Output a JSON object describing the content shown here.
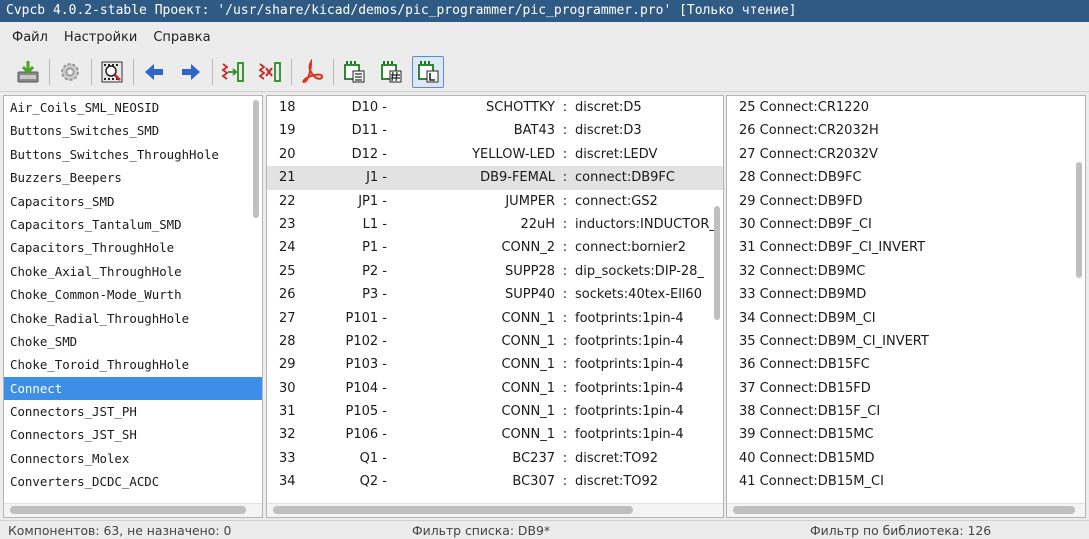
{
  "window": {
    "title": "Cvpcb 4.0.2-stable  Проект: '/usr/share/kicad/demos/pic_programmer/pic_programmer.pro' [Только чтение]"
  },
  "menu": {
    "items": [
      "Файл",
      "Настройки",
      "Справка"
    ]
  },
  "toolbar": {
    "buttons": [
      {
        "icon": "save-netlist-icon",
        "active": false
      },
      {
        "icon": "gear-icon",
        "active": false
      },
      {
        "icon": "view-footprint-icon",
        "active": false
      },
      {
        "icon": "arrow-left-icon",
        "active": false
      },
      {
        "icon": "arrow-right-icon",
        "active": false
      },
      {
        "icon": "auto-associate-icon",
        "active": false
      },
      {
        "icon": "delete-association-icon",
        "active": false
      },
      {
        "icon": "pdf-icon",
        "active": false
      },
      {
        "icon": "filter-keywords-icon",
        "active": false
      },
      {
        "icon": "filter-pincount-icon",
        "active": false
      },
      {
        "icon": "filter-library-icon",
        "active": true
      }
    ],
    "accent_color": "#3d8ee6"
  },
  "libraries": {
    "selected_index": 12,
    "items": [
      "Air_Coils_SML_NEOSID",
      "Buttons_Switches_SMD",
      "Buttons_Switches_ThroughHole",
      "Buzzers_Beepers",
      "Capacitors_SMD",
      "Capacitors_Tantalum_SMD",
      "Capacitors_ThroughHole",
      "Choke_Axial_ThroughHole",
      "Choke_Common-Mode_Wurth",
      "Choke_Radial_ThroughHole",
      "Choke_SMD",
      "Choke_Toroid_ThroughHole",
      "Connect",
      "Connectors_JST_PH",
      "Connectors_JST_SH",
      "Connectors_Molex",
      "Converters_DCDC_ACDC"
    ]
  },
  "components": {
    "highlight_index": 3,
    "rows": [
      {
        "idx": "18",
        "ref": "D10",
        "value": "SCHOTTKY",
        "footprint": "discret:D5"
      },
      {
        "idx": "19",
        "ref": "D11",
        "value": "BAT43",
        "footprint": "discret:D3"
      },
      {
        "idx": "20",
        "ref": "D12",
        "value": "YELLOW-LED",
        "footprint": "discret:LEDV"
      },
      {
        "idx": "21",
        "ref": "J1",
        "value": "DB9-FEMAL",
        "footprint": "connect:DB9FC"
      },
      {
        "idx": "22",
        "ref": "JP1",
        "value": "JUMPER",
        "footprint": "connect:GS2"
      },
      {
        "idx": "23",
        "ref": "L1",
        "value": "22uH",
        "footprint": "inductors:INDUCTOR_"
      },
      {
        "idx": "24",
        "ref": "P1",
        "value": "CONN_2",
        "footprint": "connect:bornier2"
      },
      {
        "idx": "25",
        "ref": "P2",
        "value": "SUPP28",
        "footprint": "dip_sockets:DIP-28_"
      },
      {
        "idx": "26",
        "ref": "P3",
        "value": "SUPP40",
        "footprint": "sockets:40tex-Ell60"
      },
      {
        "idx": "27",
        "ref": "P101",
        "value": "CONN_1",
        "footprint": "footprints:1pin-4"
      },
      {
        "idx": "28",
        "ref": "P102",
        "value": "CONN_1",
        "footprint": "footprints:1pin-4"
      },
      {
        "idx": "29",
        "ref": "P103",
        "value": "CONN_1",
        "footprint": "footprints:1pin-4"
      },
      {
        "idx": "30",
        "ref": "P104",
        "value": "CONN_1",
        "footprint": "footprints:1pin-4"
      },
      {
        "idx": "31",
        "ref": "P105",
        "value": "CONN_1",
        "footprint": "footprints:1pin-4"
      },
      {
        "idx": "32",
        "ref": "P106",
        "value": "CONN_1",
        "footprint": "footprints:1pin-4"
      },
      {
        "idx": "33",
        "ref": "Q1",
        "value": "BC237",
        "footprint": "discret:TO92"
      },
      {
        "idx": "34",
        "ref": "Q2",
        "value": "BC307",
        "footprint": "discret:TO92"
      }
    ]
  },
  "footprints": {
    "items": [
      "25 Connect:CR1220",
      "26 Connect:CR2032H",
      "27 Connect:CR2032V",
      "28 Connect:DB9FC",
      "29 Connect:DB9FD",
      "30 Connect:DB9F_CI",
      "31 Connect:DB9F_CI_INVERT",
      "32 Connect:DB9MC",
      "33 Connect:DB9MD",
      "34 Connect:DB9M_CI",
      "35 Connect:DB9M_CI_INVERT",
      "36 Connect:DB15FC",
      "37 Connect:DB15FD",
      "38 Connect:DB15F_CI",
      "39 Connect:DB15MC",
      "40 Connect:DB15MD",
      "41 Connect:DB15M_CI"
    ]
  },
  "status": {
    "components": "Компонентов: 63, не назначено: 0",
    "list_filter": "Фильтр списка: DB9*",
    "library_filter": "Фильтр по библиотека: 126"
  }
}
